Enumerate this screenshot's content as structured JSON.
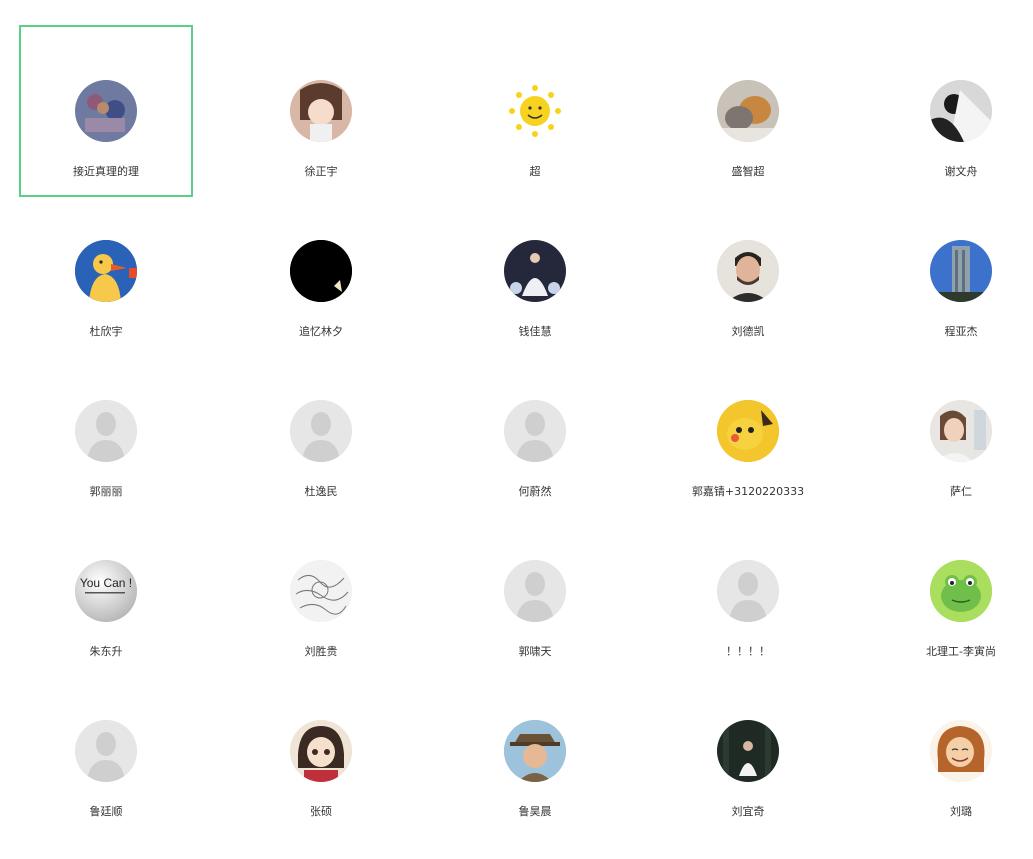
{
  "contacts": [
    {
      "name": "接近真理的理",
      "avatar": "stitch-avatar-icon",
      "selected": true
    },
    {
      "name": "徐正宇",
      "avatar": "anime-girl-avatar-icon"
    },
    {
      "name": "超",
      "avatar": "sun-avatar-icon"
    },
    {
      "name": "盛智超",
      "avatar": "dog-photo-avatar-icon"
    },
    {
      "name": "谢文舟",
      "avatar": "bw-photo-avatar-icon"
    },
    {
      "name": "杜欣宇",
      "avatar": "duck-avatar-icon"
    },
    {
      "name": "追忆林夕",
      "avatar": "black-avatar-icon"
    },
    {
      "name": "钱佳慧",
      "avatar": "bride-photo-avatar-icon"
    },
    {
      "name": "刘德凯",
      "avatar": "man-photo-avatar-icon"
    },
    {
      "name": "程亚杰",
      "avatar": "building-photo-avatar-icon"
    },
    {
      "name": "郭丽丽",
      "avatar": "default-avatar-icon"
    },
    {
      "name": "杜逸民",
      "avatar": "default-avatar-icon"
    },
    {
      "name": "何蔚然",
      "avatar": "default-avatar-icon"
    },
    {
      "name": "郭嘉锖+3120220333",
      "avatar": "pikachu-avatar-icon"
    },
    {
      "name": "萨仁",
      "avatar": "child-photo-avatar-icon"
    },
    {
      "name": "朱东升",
      "avatar": "you-can-avatar-icon",
      "avatar_text": "You Can !"
    },
    {
      "name": "刘胜贵",
      "avatar": "sketch-avatar-icon"
    },
    {
      "name": "郭啸天",
      "avatar": "default-avatar-icon"
    },
    {
      "name": "！！！！",
      "avatar": "default-avatar-icon"
    },
    {
      "name": "北理工-李寅尚",
      "avatar": "frog-avatar-icon"
    },
    {
      "name": "鲁廷顺",
      "avatar": "default-avatar-icon"
    },
    {
      "name": "张硕",
      "avatar": "anime-girl2-avatar-icon"
    },
    {
      "name": "鲁昊晨",
      "avatar": "detective-avatar-icon"
    },
    {
      "name": "刘宜奇",
      "avatar": "forest-photo-avatar-icon"
    },
    {
      "name": "刘璐",
      "avatar": "cartoon-girl-avatar-icon"
    }
  ],
  "colors": {
    "selection_border": "#5ccf84",
    "name_text": "#333333",
    "default_avatar_bg": "#e6e6e6",
    "default_avatar_figure": "#cfcfcf"
  }
}
